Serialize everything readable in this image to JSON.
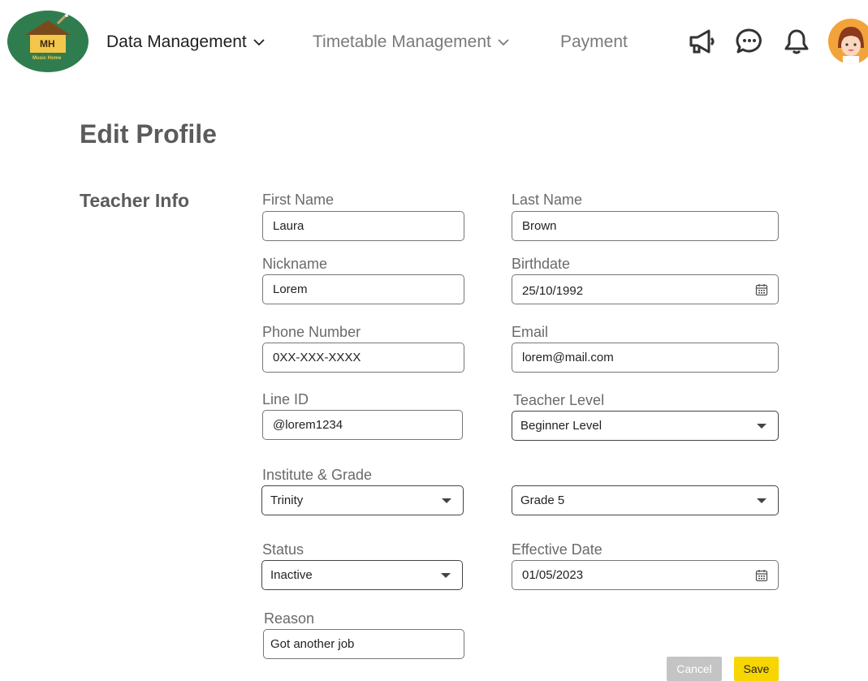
{
  "header": {
    "logo": {
      "text": "MH",
      "subtext": "Music Home",
      "color": "#2f7d4f"
    },
    "nav": [
      {
        "label": "Data Management",
        "active": true,
        "has_dropdown": true
      },
      {
        "label": "Timetable Management",
        "active": false,
        "has_dropdown": true
      },
      {
        "label": "Payment",
        "active": false,
        "has_dropdown": false
      }
    ],
    "icons": [
      "megaphone-icon",
      "chat-icon",
      "bell-icon"
    ],
    "avatar_color": "#f2a43a"
  },
  "page": {
    "title": "Edit Profile",
    "section_title": "Teacher Info"
  },
  "form": {
    "first_name": {
      "label": "First Name",
      "value": "Laura"
    },
    "last_name": {
      "label": "Last Name",
      "value": "Brown"
    },
    "nickname": {
      "label": "Nickname",
      "value": "Lorem"
    },
    "birthdate": {
      "label": "Birthdate",
      "value": "25/10/1992"
    },
    "phone": {
      "label": "Phone Number",
      "value": "0XX-XXX-XXXX"
    },
    "email": {
      "label": "Email",
      "value": "lorem@mail.com"
    },
    "line_id": {
      "label": "Line ID",
      "value": "@lorem1234"
    },
    "teacher_level": {
      "label": "Teacher Level",
      "value": "Beginner Level"
    },
    "institute_grade": {
      "label": "Institute & Grade",
      "institute": "Trinity",
      "grade": "Grade 5"
    },
    "status": {
      "label": "Status",
      "value": "Inactive"
    },
    "effective_date": {
      "label": "Effective Date",
      "value": "01/05/2023"
    },
    "reason": {
      "label": "Reason",
      "value": "Got another job"
    }
  },
  "actions": {
    "cancel_label": "Cancel",
    "save_label": "Save",
    "save_color": "#f7d500",
    "cancel_color": "#c4c4c4"
  }
}
